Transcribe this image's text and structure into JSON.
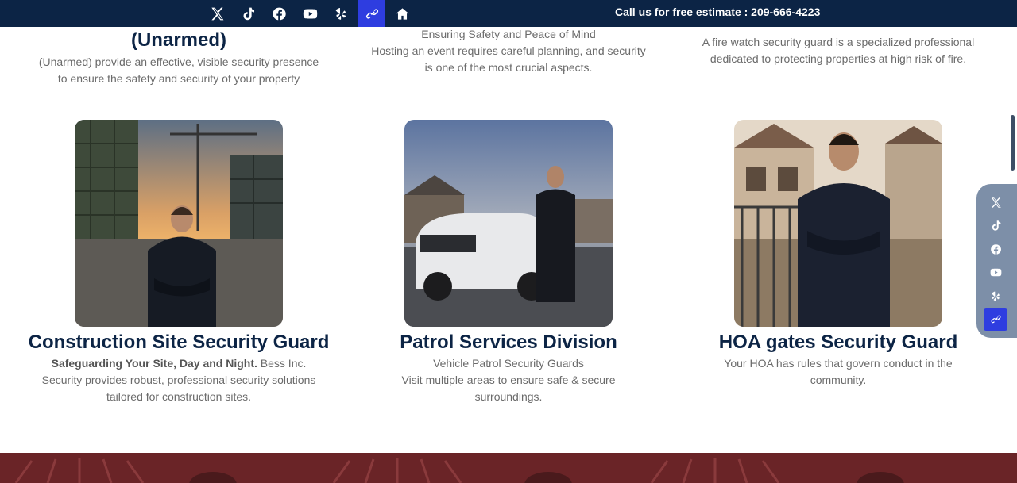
{
  "topbar": {
    "icons": [
      "x-twitter-icon",
      "tiktok-icon",
      "facebook-icon",
      "youtube-icon",
      "yelp-icon",
      "link-icon",
      "home-icon"
    ],
    "call_text": "Call us for free estimate : 209-666-4223",
    "active_color": "#2e3de0",
    "bg_color": "#0c2445"
  },
  "top_row": {
    "left": {
      "title_line2": "(Unarmed)",
      "desc_lines": [
        "(Unarmed) provide an effective, visible security presence",
        "to ensure the safety and security of your property"
      ]
    },
    "middle": {
      "desc_lines": [
        "Ensuring Safety and Peace of Mind",
        "Hosting an event requires careful planning, and security",
        "is one of the most crucial aspects."
      ]
    },
    "right": {
      "desc_lines": [
        "A fire watch security guard is a specialized professional",
        "dedicated to protecting properties at high risk of fire."
      ]
    }
  },
  "cards": [
    {
      "title": "Construction Site Security Guard",
      "desc_bold": "Safeguarding Your Site, Day and Night.",
      "desc_rest": " Bess Inc.",
      "desc_lines": [
        "Security provides robust, professional security solutions",
        "tailored for construction sites."
      ]
    },
    {
      "title": "Patrol Services Division",
      "desc_lines": [
        "Vehicle Patrol Security Guards",
        "Visit multiple areas to ensure safe & secure",
        "surroundings."
      ]
    },
    {
      "title": "HOA gates Security Guard",
      "desc_lines": [
        "Your HOA has rules that govern conduct in the",
        "community."
      ]
    }
  ],
  "rail": {
    "icons": [
      "x-twitter-icon",
      "tiktok-icon",
      "facebook-icon",
      "youtube-icon",
      "yelp-icon",
      "link-icon"
    ],
    "bg_color": "#7d8fa8"
  },
  "band_color": "#6a2427"
}
